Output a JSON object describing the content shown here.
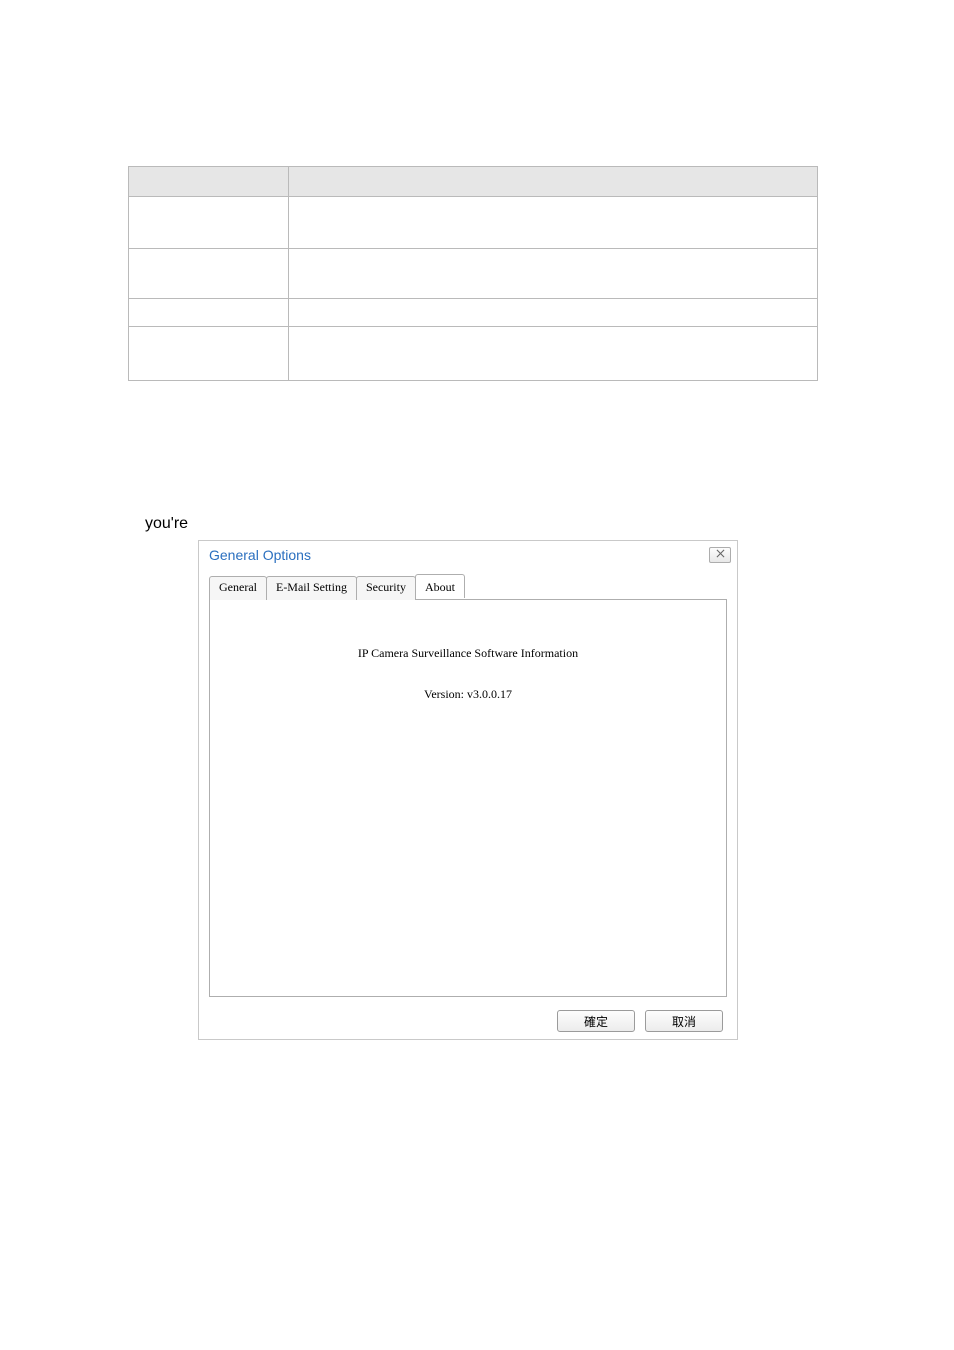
{
  "page_text": {
    "youre": "you're"
  },
  "dialog": {
    "title": "General Options",
    "tabs": {
      "general": "General",
      "email": "E-Mail Setting",
      "security": "Security",
      "about": "About"
    },
    "about_panel": {
      "info_title": "IP Camera Surveillance Software Information",
      "version": "Version: v3.0.0.17"
    },
    "buttons": {
      "ok": "確定",
      "cancel": "取消"
    }
  }
}
